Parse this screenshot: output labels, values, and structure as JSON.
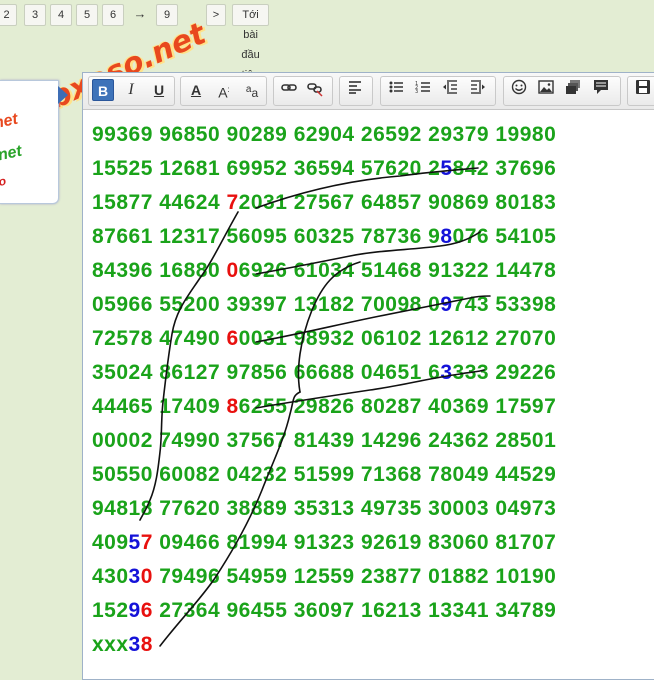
{
  "pagination": {
    "pages": [
      "2",
      "3",
      "4",
      "5",
      "6"
    ],
    "arrow": "→",
    "last_page": "9",
    "next_label": ">",
    "first_unread_label": "Tới bài đầu tiên chưa đọc"
  },
  "watermark": {
    "text": "webxoso.net"
  },
  "toolbar": {
    "bold": "B",
    "italic": "I",
    "underline": "U",
    "font_color": "A",
    "font_size": "A",
    "font_case": "a"
  },
  "lottery_rows": [
    [
      {
        "t": "99369 96850 90289 62904 26592 29379 19980"
      }
    ],
    [
      {
        "t": "15525 12681 69952 36594 57620 2"
      },
      {
        "t": "5",
        "c": "blue"
      },
      {
        "t": "842 37696"
      }
    ],
    [
      {
        "t": "15877 44624 "
      },
      {
        "t": "7",
        "c": "red"
      },
      {
        "t": "2031 27567 64857 90869 80183"
      }
    ],
    [
      {
        "t": "87661 12317 56095 60325 78736 9"
      },
      {
        "t": "8",
        "c": "blue"
      },
      {
        "t": "076 54105"
      }
    ],
    [
      {
        "t": "84396 16880 "
      },
      {
        "t": "0",
        "c": "red"
      },
      {
        "t": "6926 61034 51468 91322 14478"
      }
    ],
    [
      {
        "t": "05966 55200 39397 13182 70098 0"
      },
      {
        "t": "9",
        "c": "blue"
      },
      {
        "t": "743 53398"
      }
    ],
    [
      {
        "t": "72578 47490 "
      },
      {
        "t": "6",
        "c": "red"
      },
      {
        "t": "0031 98932 06102 12612 27070"
      }
    ],
    [
      {
        "t": "35024 86127 97856 66688 04651 6"
      },
      {
        "t": "3",
        "c": "blue"
      },
      {
        "t": "333 29226"
      }
    ],
    [
      {
        "t": "44465 17409 "
      },
      {
        "t": "8",
        "c": "red"
      },
      {
        "t": "6255 29826 80287 40369 17597"
      }
    ],
    [
      {
        "t": "00002 74990 37567 81439 14296 24362 28501"
      }
    ],
    [
      {
        "t": "50550 60082 04232 51599 71368 78049 44529"
      }
    ],
    [
      {
        "t": "94818 77620 38889 35313 49735 30003 04973"
      }
    ],
    [
      {
        "t": "409"
      },
      {
        "t": "5",
        "c": "blue"
      },
      {
        "t": "7",
        "c": "red"
      },
      {
        "t": " 09466 81994 91323 92619 83060 81707"
      }
    ],
    [
      {
        "t": "430"
      },
      {
        "t": "3",
        "c": "blue"
      },
      {
        "t": "0",
        "c": "red"
      },
      {
        "t": " 79496 54959 12559 23877 01882 10190"
      }
    ],
    [
      {
        "t": "152"
      },
      {
        "t": "9",
        "c": "blue"
      },
      {
        "t": "6",
        "c": "red"
      },
      {
        "t": " 27364 96455 36097 16213 13341 34789"
      }
    ],
    [
      {
        "t": "xxx"
      },
      {
        "t": "3",
        "c": "blue"
      },
      {
        "t": "8",
        "c": "red"
      }
    ]
  ],
  "colors": {
    "digits": "#1aa31a",
    "highlight_red": "#e8100e",
    "highlight_blue": "#1412d8",
    "ink": "#111111"
  }
}
